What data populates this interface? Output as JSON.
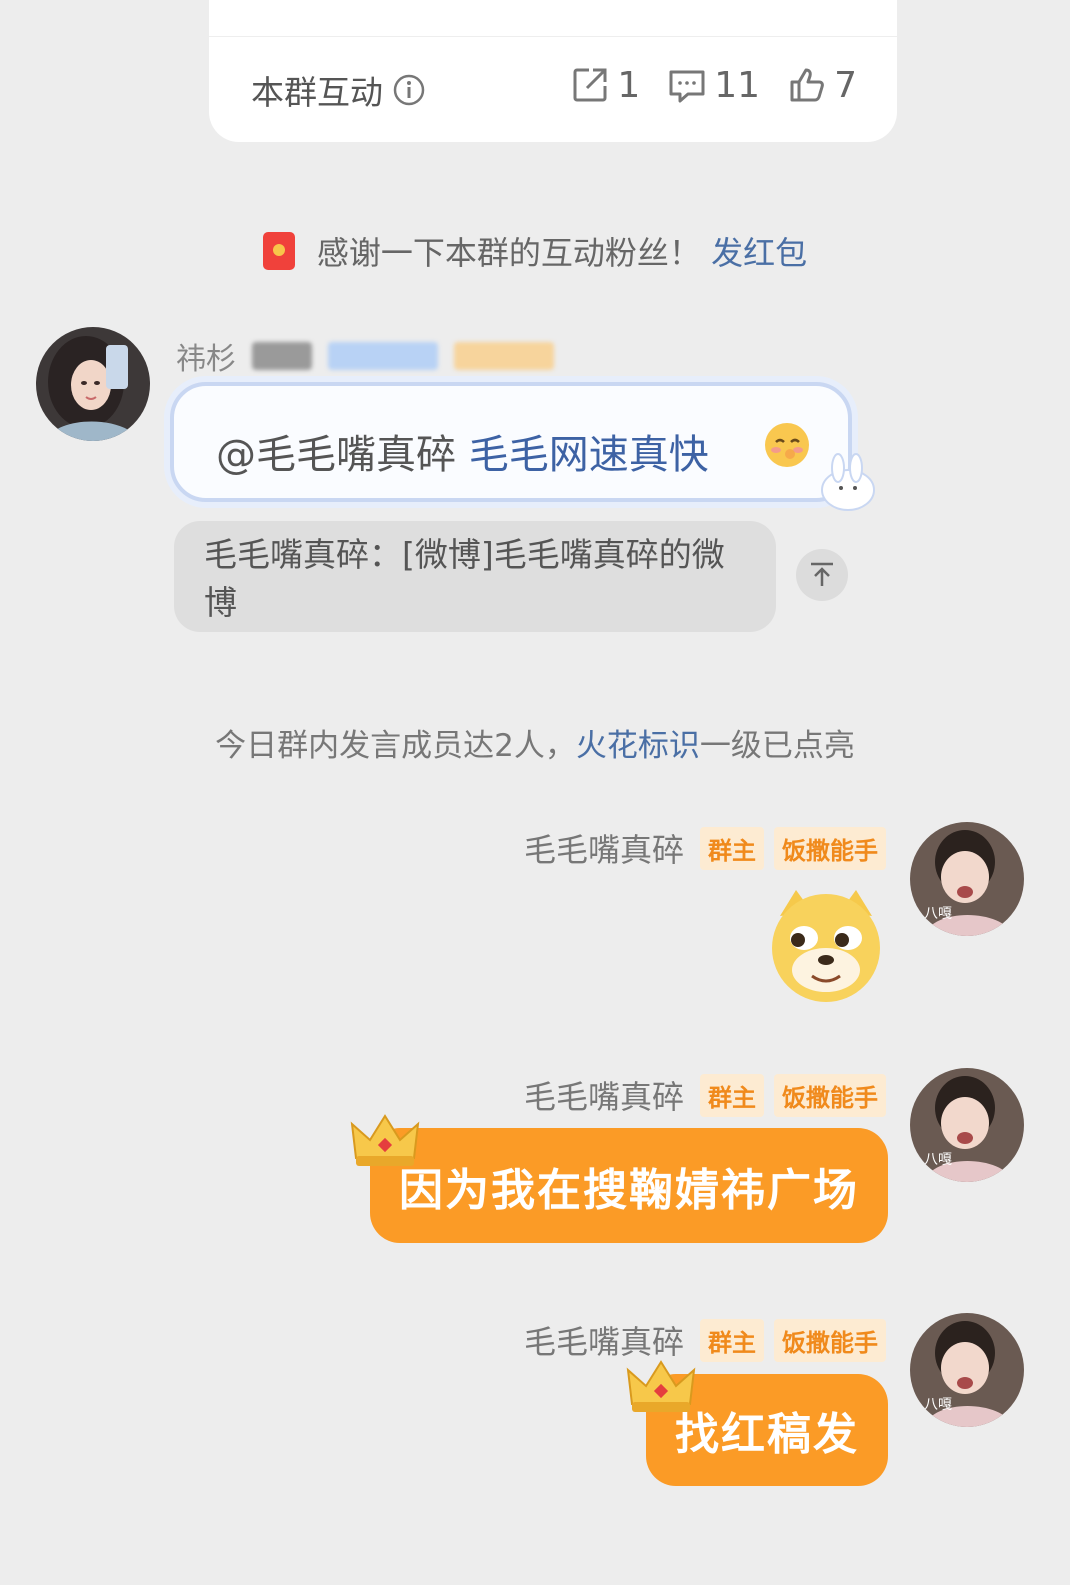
{
  "top_card": {
    "label": "本群互动",
    "stats": [
      {
        "icon": "share-icon",
        "value": "1"
      },
      {
        "icon": "comment-icon",
        "value": "11"
      },
      {
        "icon": "like-icon",
        "value": "7"
      }
    ]
  },
  "notice": {
    "text": "感谢一下本群的互动粉丝！",
    "link": "发红包"
  },
  "left_message": {
    "sender_name": "祎杉",
    "mention": "@毛毛嘴真碎",
    "text": "毛毛网速真快",
    "quote": "毛毛嘴真碎：[微博]毛毛嘴真碎的微博"
  },
  "system_message": {
    "prefix": "今日群内发言成员达2人，",
    "link": "火花标识",
    "suffix": "一级已点亮"
  },
  "right_messages": [
    {
      "sender": "毛毛嘴真碎",
      "badge1": "群主",
      "badge2": "饭撒能手",
      "content_type": "sticker",
      "sticker": "doge-sticker"
    },
    {
      "sender": "毛毛嘴真碎",
      "badge1": "群主",
      "badge2": "饭撒能手",
      "content_type": "text",
      "text": "因为我在搜鞠婧祎广场"
    },
    {
      "sender": "毛毛嘴真碎",
      "badge1": "群主",
      "badge2": "饭撒能手",
      "content_type": "text",
      "text": "找红稿发"
    }
  ],
  "colors": {
    "background": "#ededed",
    "bubble_orange": "#fb9b26",
    "badge_orange": "#f08a1c",
    "link_blue": "#4a6fa5"
  }
}
